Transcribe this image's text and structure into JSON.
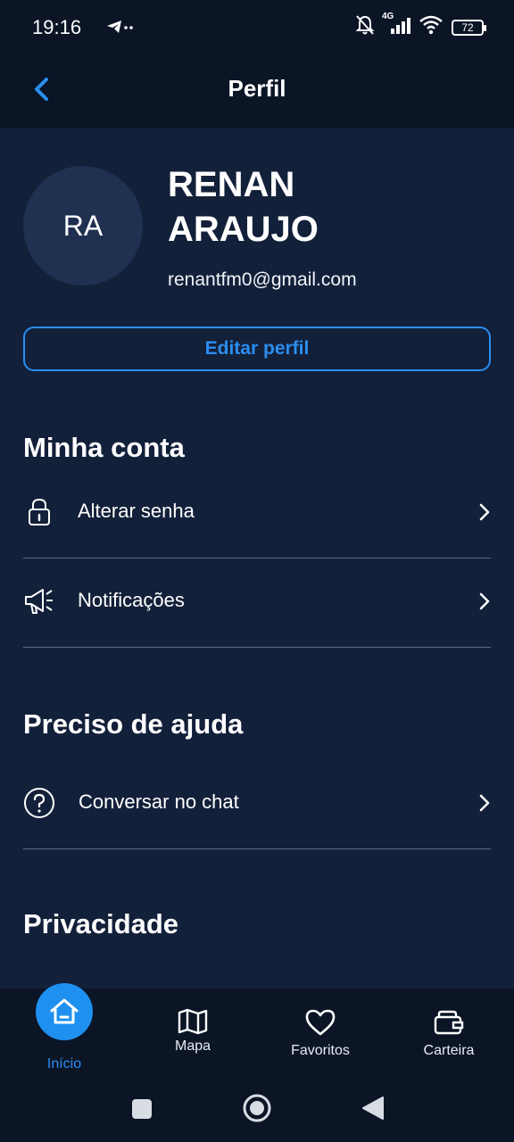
{
  "status_bar": {
    "time": "19:16",
    "network": "4G",
    "battery": "72"
  },
  "header": {
    "title": "Perfil"
  },
  "profile": {
    "initials": "RA",
    "name": "RENAN ARAUJO",
    "email": "renantfm0@gmail.com",
    "edit_label": "Editar perfil"
  },
  "sections": {
    "account": {
      "title": "Minha conta",
      "items": [
        {
          "label": "Alterar senha",
          "icon": "lock-icon"
        },
        {
          "label": "Notificações",
          "icon": "megaphone-icon"
        }
      ]
    },
    "help": {
      "title": "Preciso de ajuda",
      "items": [
        {
          "label": "Conversar no chat",
          "icon": "help-circle-icon"
        }
      ]
    },
    "privacy": {
      "title": "Privacidade"
    }
  },
  "bottom_nav": {
    "items": [
      {
        "label": "Início",
        "icon": "home-icon",
        "active": true
      },
      {
        "label": "Mapa",
        "icon": "map-icon"
      },
      {
        "label": "Favoritos",
        "icon": "heart-icon"
      },
      {
        "label": "Carteira",
        "icon": "wallet-icon"
      }
    ]
  },
  "colors": {
    "accent": "#1e90f0",
    "background": "#13203a",
    "bar": "#0b1526"
  }
}
